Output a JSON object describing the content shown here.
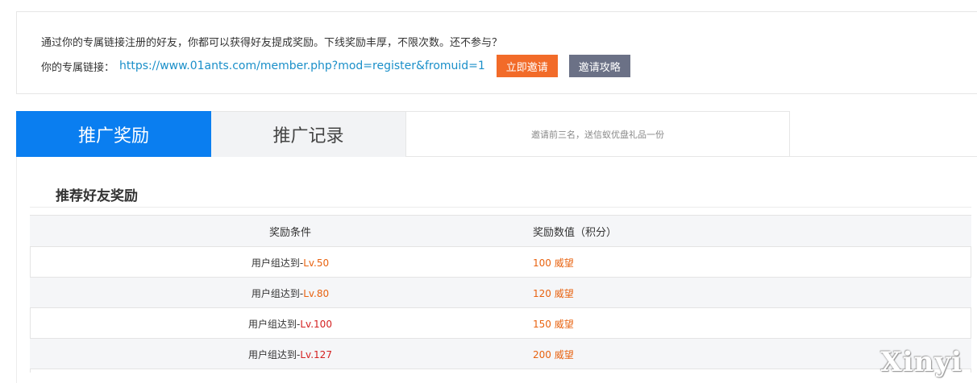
{
  "invite": {
    "description": "通过你的专属链接注册的好友，你都可以获得好友提成奖励。下线奖励丰厚，不限次数。还不参与？",
    "link_label": "你的专属链接：",
    "link_url": "https://www.01ants.com/member.php?mod=register&fromuid=1",
    "invite_button": "立即邀请",
    "guide_button": "邀请攻略"
  },
  "tabs": {
    "active_label": "推广奖励",
    "inactive_label": "推广记录",
    "note": "邀请前三名，送信蚁优盘礼品一份"
  },
  "reward": {
    "title": "推荐好友奖励",
    "headers": {
      "condition": "奖励条件",
      "value": "奖励数值（积分）"
    },
    "rows": [
      {
        "prefix": "用户组达到-",
        "level": "Lv.50",
        "value": "100 威望"
      },
      {
        "prefix": "用户组达到-",
        "level": "Lv.80",
        "value": "120 威望"
      },
      {
        "prefix": "用户组达到-",
        "level": "Lv.100",
        "value": "150 威望"
      },
      {
        "prefix": "用户组达到-",
        "level": "Lv.127",
        "value": "200 威望"
      }
    ]
  },
  "watermark": "Xinyi",
  "colors": {
    "accent_blue": "#0a7ef0",
    "invite_orange": "#f26b29",
    "guide_gray": "#6b7186",
    "link_blue": "#1a8fc9",
    "value_orange": "#e8620f",
    "level_red": "#d42020"
  }
}
